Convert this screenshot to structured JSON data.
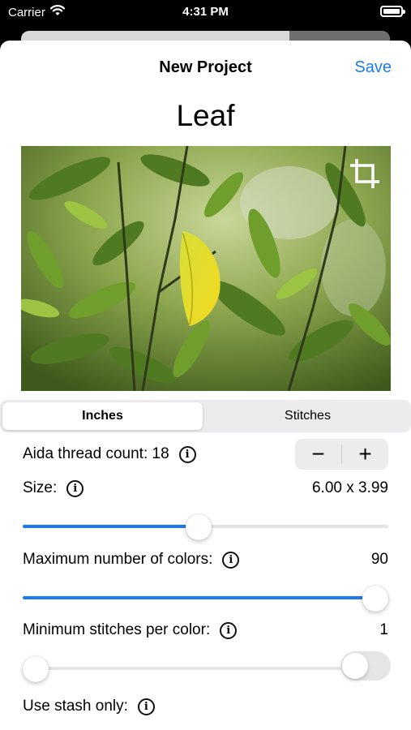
{
  "status_bar": {
    "carrier": "Carrier",
    "time": "4:31 PM",
    "icons": [
      "wifi-icon",
      "battery-icon"
    ]
  },
  "nav": {
    "title": "New Project",
    "save_label": "Save"
  },
  "project": {
    "name": "Leaf"
  },
  "photo": {
    "description_icon": "crop-icon"
  },
  "units": {
    "options": [
      "Inches",
      "Stitches"
    ],
    "selected": "Inches"
  },
  "aida": {
    "label": "Aida thread count: 18",
    "decrement_label": "−",
    "increment_label": "+"
  },
  "size": {
    "label": "Size:",
    "value": "6.00 x 3.99",
    "slider_level": 0.48
  },
  "max_colors": {
    "label": "Maximum number of colors:",
    "value": "90",
    "slider_level": 1.0
  },
  "min_stitches": {
    "label": "Minimum stitches per color:",
    "value": "1",
    "slider_level": 0.0
  },
  "stash": {
    "label": "Use stash only:",
    "enabled": false
  },
  "colors": {
    "accent": "#1a7cf0",
    "track": "#e3e3e6",
    "segment_bg": "#ececee"
  }
}
